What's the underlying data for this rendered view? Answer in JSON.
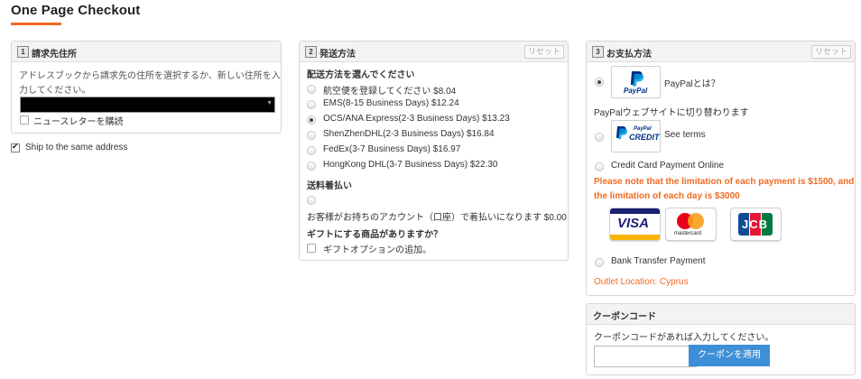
{
  "page": {
    "title": "One Page Checkout"
  },
  "colors": {
    "accent": "#f26a21",
    "button_blue": "#3e8fd8"
  },
  "billing": {
    "step": "1",
    "title": "請求先住所",
    "instruction_line1": "アドレスブックから請求先の住所を選択するか、新しい住所を入",
    "instruction_line2": "力してください。",
    "newsletter_label": "ニュースレターを購読",
    "newsletter_checked": false
  },
  "ship_same": {
    "label": "Ship to the same address",
    "checked": true
  },
  "shipping": {
    "step": "2",
    "title": "発送方法",
    "reset_label": "リセット",
    "section_title": "配送方法を選んでください",
    "options": [
      {
        "label": "航空便を登録してください $8.04",
        "selected": false
      },
      {
        "label": "EMS(8-15 Business Days) $12.24",
        "selected": false
      },
      {
        "label": "OCS/ANA Express(2-3 Business Days) $13.23",
        "selected": true
      },
      {
        "label": "ShenZhenDHL(2-3 Business Days) $16.84",
        "selected": false
      },
      {
        "label": "FedEx(3-7 Business Days) $16.97",
        "selected": false
      },
      {
        "label": "HongKong DHL(3-7 Business Days) $22.30",
        "selected": false
      }
    ],
    "collect_title": "送料着払い",
    "collect_desc": "お客様がお持ちのアカウント（口座）で着払いになります $0.00",
    "gift_title": "ギフトにする商品がありますか？",
    "gift_option_label": "ギフトオプションの追加。"
  },
  "payment": {
    "step": "3",
    "title": "お支払方法",
    "reset_label": "リセット",
    "paypal_logo_text": "PayPal",
    "paypal_what": "PayPalとは？",
    "paypal_redirect": "PayPalウェブサイトに切り替わります",
    "paypal_credit_logo_text": "PayPal",
    "paypal_credit_logo_sub": "CREDIT",
    "see_terms": "See terms",
    "credit_card_label": "Credit Card Payment Online",
    "limit_note_line1": "Please note that the limitation of each payment is $1500, and",
    "limit_note_line2": "the limitation of each day is $3000",
    "card_visa": "VISA",
    "card_mastercard": "mastercard",
    "card_jcb": "JCB",
    "bank_transfer_label": "Bank Transfer Payment",
    "outlet_location": "Outlet Location: Cyprus",
    "selected": "paypal"
  },
  "coupon": {
    "title": "クーポンコード",
    "instruction": "クーポンコードがあれば入力してください。",
    "input_value": "",
    "apply_label": "クーポンを適用"
  }
}
